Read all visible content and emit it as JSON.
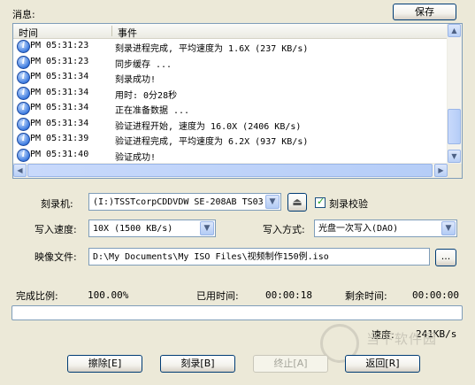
{
  "messages_label": "消息:",
  "save_button": "保存",
  "log": {
    "columns": [
      "时间",
      "事件"
    ],
    "rows": [
      {
        "time": "PM 05:31:23",
        "event": "刻录进程完成, 平均速度为 1.6X (237 KB/s)"
      },
      {
        "time": "PM 05:31:23",
        "event": "同步缓存 ..."
      },
      {
        "time": "PM 05:31:34",
        "event": "刻录成功!"
      },
      {
        "time": "PM 05:31:34",
        "event": "用时: 0分28秒"
      },
      {
        "time": "PM 05:31:34",
        "event": "正在准备数据 ..."
      },
      {
        "time": "PM 05:31:34",
        "event": "验证进程开始, 速度为 16.0X (2406 KB/s)"
      },
      {
        "time": "PM 05:31:39",
        "event": "验证进程完成, 平均速度为 6.2X (937 KB/s)"
      },
      {
        "time": "PM 05:31:40",
        "event": "验证成功!"
      }
    ]
  },
  "form": {
    "burner_label": "刻录机:",
    "burner_value": "(I:)TSSTcorpCDDVDW SE-208AB TS03",
    "verify_label": "刻录校验",
    "verify_checked": true,
    "write_speed_label": "写入速度:",
    "write_speed_value": "10X (1500 KB/s)",
    "write_mode_label": "写入方式:",
    "write_mode_value": "光盘一次写入(DAO)",
    "image_file_label": "映像文件:",
    "image_file_value": "D:\\My Documents\\My ISO Files\\视频制作150例.iso",
    "browse_label": "..."
  },
  "status": {
    "completion_label": "完成比例:",
    "completion_value": "100.00%",
    "elapsed_label": "已用时间:",
    "elapsed_value": "00:00:18",
    "remaining_label": "剩余时间:",
    "remaining_value": "00:00:00",
    "progress_fraction": 0,
    "speed_label": "速度:",
    "speed_value": "241KB/s"
  },
  "buttons": {
    "erase": "擦除[E]",
    "burn": "刻录[B]",
    "stop": "终止[A]",
    "back": "返回[R]"
  },
  "watermark": "当下软件园"
}
